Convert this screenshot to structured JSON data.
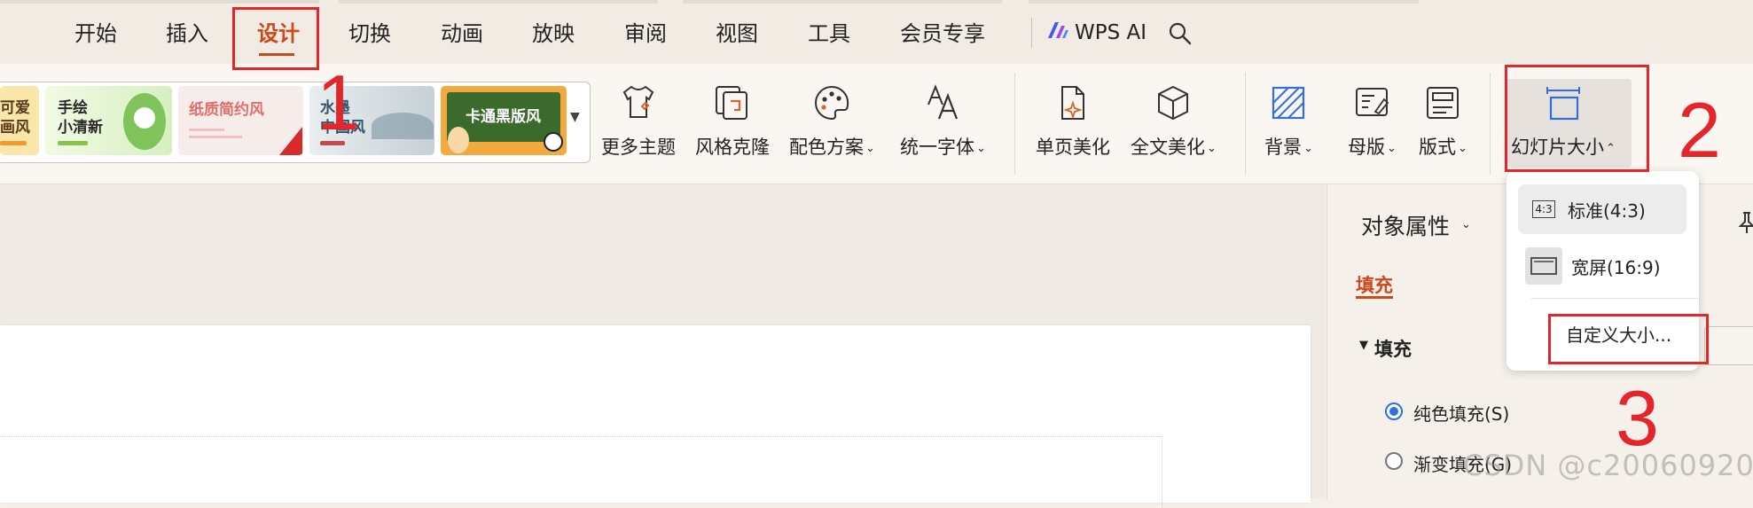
{
  "menu": {
    "tabs": [
      {
        "label": "开始"
      },
      {
        "label": "插入"
      },
      {
        "label": "设计"
      },
      {
        "label": "切换"
      },
      {
        "label": "动画"
      },
      {
        "label": "放映"
      },
      {
        "label": "审阅"
      },
      {
        "label": "视图"
      },
      {
        "label": "工具"
      },
      {
        "label": "会员专享"
      }
    ],
    "active_tab": "设计",
    "wps_ai": "WPS AI"
  },
  "themes": [
    {
      "label": "可爱\n画风"
    },
    {
      "label": "手绘\n小清新"
    },
    {
      "label": "纸质简约风"
    },
    {
      "label": "水墨\n中国风"
    },
    {
      "label": "卡通黑版风"
    }
  ],
  "ribbon": {
    "more_themes": "更多主题",
    "style_clone": "风格克隆",
    "color_scheme": "配色方案",
    "unified_font": "统一字体",
    "page_beautify": "单页美化",
    "full_beautify": "全文美化",
    "background": "背景",
    "master": "母版",
    "layout": "版式",
    "slide_size": "幻灯片大小"
  },
  "dropdown": {
    "standard_icon": "4:3",
    "standard": "标准(4:3)",
    "widescreen": "宽屏(16:9)",
    "custom": "自定义大小..."
  },
  "pane": {
    "title": "对象属性",
    "tab_fill": "填充",
    "section_fill": "填充",
    "solid_fill": "纯色填充(S)",
    "gradient_fill": "渐变填充(G)"
  },
  "annotations": {
    "n1": "1",
    "n2": "2",
    "n3": "3"
  },
  "watermark": "CSDN @c20060920",
  "colors": {
    "accent": "#c94a1c",
    "annotation": "#e4252a",
    "radio": "#2f6fe0"
  }
}
